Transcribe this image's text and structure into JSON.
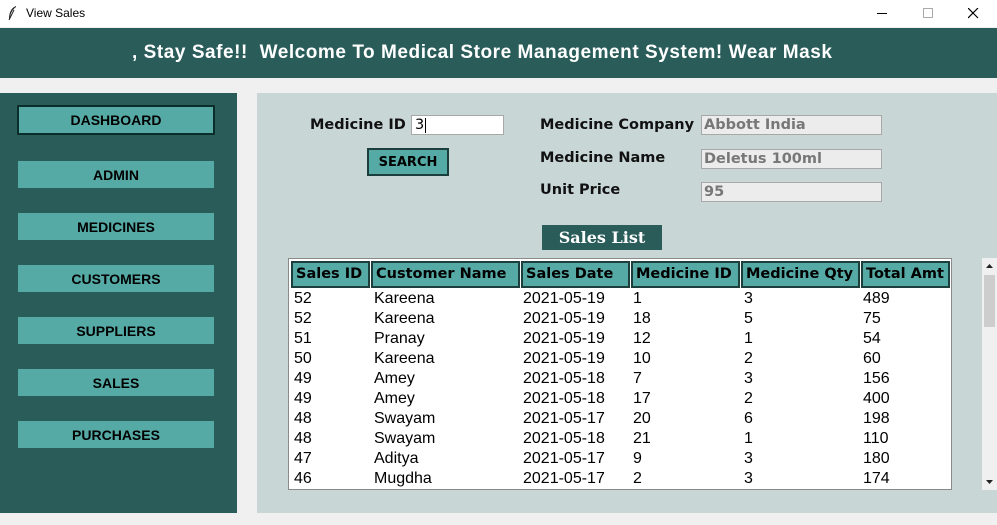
{
  "window": {
    "title": "View Sales"
  },
  "marquee": {
    "text": ", Stay Safe!!  Welcome To Medical Store Management System! Wear Mask"
  },
  "sidebar": {
    "items": [
      {
        "label": "DASHBOARD"
      },
      {
        "label": "ADMIN"
      },
      {
        "label": "MEDICINES"
      },
      {
        "label": "CUSTOMERS"
      },
      {
        "label": "SUPPLIERS"
      },
      {
        "label": "SALES"
      },
      {
        "label": "PURCHASES"
      }
    ]
  },
  "form": {
    "medicine_id_label": "Medicine ID",
    "medicine_id_value": "3",
    "search_label": "SEARCH",
    "company_label": "Medicine Company",
    "company_value": "Abbott India",
    "name_label": "Medicine Name",
    "name_value": "Deletus 100ml",
    "price_label": "Unit Price",
    "price_value": "95"
  },
  "sales_list": {
    "title": "Sales List",
    "columns": [
      "Sales ID",
      "Customer Name",
      "Sales Date",
      "Medicine ID",
      "Medicine Qty",
      "Total Amt"
    ],
    "rows": [
      [
        "52",
        "Kareena",
        "2021-05-19",
        "1",
        "3",
        "489"
      ],
      [
        "52",
        "Kareena",
        "2021-05-19",
        "18",
        "5",
        "75"
      ],
      [
        "51",
        "Pranay",
        "2021-05-19",
        "12",
        "1",
        "54"
      ],
      [
        "50",
        "Kareena",
        "2021-05-19",
        "10",
        "2",
        "60"
      ],
      [
        "49",
        "Amey",
        "2021-05-18",
        "7",
        "3",
        "156"
      ],
      [
        "49",
        "Amey",
        "2021-05-18",
        "17",
        "2",
        "400"
      ],
      [
        "48",
        "Swayam",
        "2021-05-17",
        "20",
        "6",
        "198"
      ],
      [
        "48",
        "Swayam",
        "2021-05-18",
        "21",
        "1",
        "110"
      ],
      [
        "47",
        "Aditya",
        "2021-05-17",
        "9",
        "3",
        "180"
      ],
      [
        "46",
        "Mugdha",
        "2021-05-17",
        "2",
        "3",
        "174"
      ]
    ]
  },
  "colors": {
    "header_bg": "#2a5d5a",
    "button_bg": "#55aaa6",
    "panel_bg": "#c9d6d6"
  }
}
